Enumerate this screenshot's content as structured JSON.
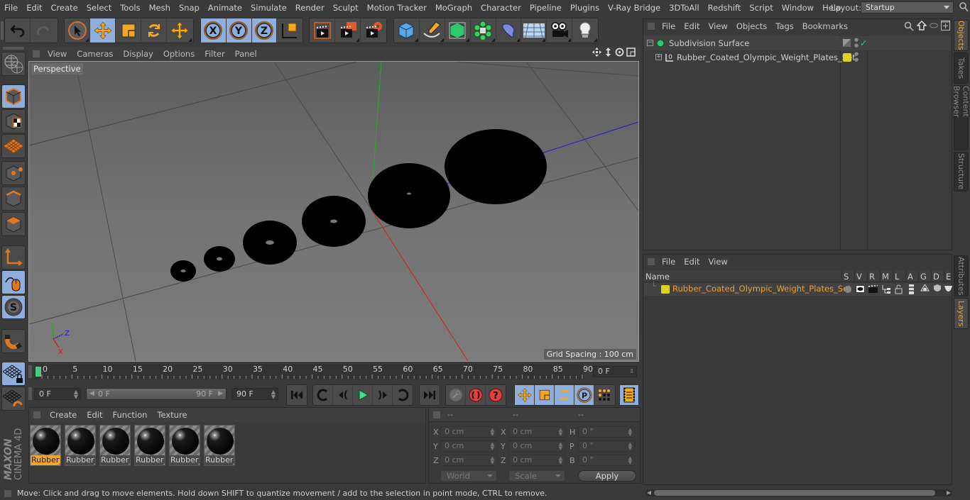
{
  "menubar": {
    "items": [
      "File",
      "Edit",
      "Create",
      "Select",
      "Tools",
      "Mesh",
      "Snap",
      "Animate",
      "Simulate",
      "Render",
      "Sculpt",
      "Motion Tracker",
      "MoGraph",
      "Character",
      "Pipeline",
      "Plugins",
      "V-Ray Bridge",
      "3DToAll",
      "Redshift",
      "Script",
      "Window",
      "Help"
    ],
    "layout_label": "Layout:",
    "layout_value": "Startup"
  },
  "toolbar": {
    "icons": [
      "undo-icon",
      "redo-icon",
      "live-selection-icon",
      "move-icon",
      "scale-icon",
      "rotate-icon",
      "recent-tool-icon",
      "x-axis-lock-icon",
      "y-axis-lock-icon",
      "z-axis-lock-icon",
      "coordinate-system-icon",
      "render-view-icon",
      "render-picture-viewer-icon",
      "render-settings-icon",
      "cube-primitive-icon",
      "pen-spline-icon",
      "subdivision-surface-icon",
      "cloner-icon",
      "deformer-icon",
      "floor-icon",
      "camera-icon",
      "light-icon"
    ],
    "x_label": "X",
    "y_label": "Y",
    "z_label": "Z"
  },
  "left_palette": {
    "tools": [
      "make-editable-icon",
      "model-mode-icon",
      "texture-mode-icon",
      "workplane-mode-icon",
      "points-mode-icon",
      "edges-mode-icon",
      "polygons-mode-icon",
      "axis-mode-icon",
      "tweak-mode-icon",
      "solo-mode-icon",
      "snapping-icon",
      "locked-workplane-icon",
      "planar-workplane-icon"
    ],
    "solo_label": "S",
    "brand": "MAXON",
    "product": "CINEMA 4D"
  },
  "viewport": {
    "menu": [
      "View",
      "Cameras",
      "Display",
      "Options",
      "Filter",
      "Panel"
    ],
    "camera_label": "Perspective",
    "grid_spacing": "Grid Spacing : 100 cm",
    "axis_labels": {
      "x": "X",
      "y": "Y",
      "z": "Z"
    },
    "colors": {
      "x_axis": "#d02020",
      "y_axis": "#20b020",
      "z_axis": "#2020c0"
    }
  },
  "timeline": {
    "ticks": [
      "0",
      "5",
      "10",
      "15",
      "20",
      "25",
      "30",
      "35",
      "40",
      "45",
      "50",
      "55",
      "60",
      "65",
      "70",
      "75",
      "80",
      "85",
      "90"
    ],
    "current_frame_field": "0 F",
    "start_field": "0 F",
    "range_start": "0 F",
    "range_end": "90 F",
    "end_field": "90 F",
    "current_frame": 0,
    "max_frame": 90
  },
  "transport": {
    "buttons": [
      "go-to-start-icon",
      "go-to-previous-key-icon",
      "previous-frame-icon",
      "play-forward-icon",
      "next-frame-icon",
      "go-to-next-key-icon",
      "go-to-end-icon",
      "record-active-objects-icon",
      "autokeying-icon",
      "keyframe-selection-icon",
      "record-position-icon",
      "record-scale-icon",
      "record-rotation-icon",
      "record-parameter-icon",
      "record-point-level-icon",
      "timeline-icon"
    ],
    "param_label": "P",
    "help_label": "?"
  },
  "material_manager": {
    "menu": [
      "Create",
      "Edit",
      "Function",
      "Texture"
    ],
    "materials": [
      {
        "label": "Rubber_",
        "selected": true
      },
      {
        "label": "Rubber_",
        "selected": false
      },
      {
        "label": "Rubber_",
        "selected": false
      },
      {
        "label": "Rubber_",
        "selected": false
      },
      {
        "label": "Rubber_",
        "selected": false
      },
      {
        "label": "Rubber_",
        "selected": false
      }
    ]
  },
  "coordinates": {
    "headers": [
      "--",
      "--",
      "--"
    ],
    "rows": [
      {
        "l1": "X",
        "v1": "0 cm",
        "l2": "X",
        "v2": "0 cm",
        "l3": "H",
        "v3": "0 °"
      },
      {
        "l1": "Y",
        "v1": "0 cm",
        "l2": "Y",
        "v2": "0 cm",
        "l3": "P",
        "v3": "0 °"
      },
      {
        "l1": "Z",
        "v1": "0 cm",
        "l2": "Z",
        "v2": "0 cm",
        "l3": "B",
        "v3": "0 °"
      }
    ],
    "space_select": "World",
    "mode_select": "Scale",
    "apply_label": "Apply"
  },
  "status": {
    "text": "Move: Click and drag to move elements. Hold down SHIFT to quantize movement / add to the selection in point mode, CTRL to remove."
  },
  "object_manager": {
    "menu": [
      "File",
      "Edit",
      "View",
      "Objects",
      "Tags",
      "Bookmarks"
    ],
    "objects": [
      {
        "name": "Subdivision Surface",
        "icon": "subdivision-surface-icon",
        "enabled_check": "✓"
      },
      {
        "name": "Rubber_Coated_Olympic_Weight_Plates_Set",
        "icon": "null-object-icon",
        "layer_color": "#e0d020"
      }
    ]
  },
  "layer_manager": {
    "menu": [
      "File",
      "Edit",
      "View"
    ],
    "columns": [
      "Name",
      "S",
      "V",
      "R",
      "M",
      "L",
      "A",
      "G",
      "D",
      "E"
    ],
    "layers": [
      {
        "name": "Rubber_Coated_Olympic_Weight_Plates_Set",
        "color": "#e0d020",
        "text_color": "#f0a030"
      }
    ]
  },
  "right_tabs": {
    "top": [
      {
        "label": "Objects",
        "active": true
      },
      {
        "label": "Takes",
        "active": false
      },
      {
        "label": "Content Browser",
        "active": false
      },
      {
        "label": "Structure",
        "active": false
      }
    ],
    "bottom": [
      {
        "label": "Attributes",
        "active": false
      },
      {
        "label": "Layers",
        "active": true
      }
    ]
  },
  "accent_colors": {
    "orange": "#f2a42b",
    "selection_blue": "#8eaede",
    "frame_marker": "#4ecb83"
  }
}
